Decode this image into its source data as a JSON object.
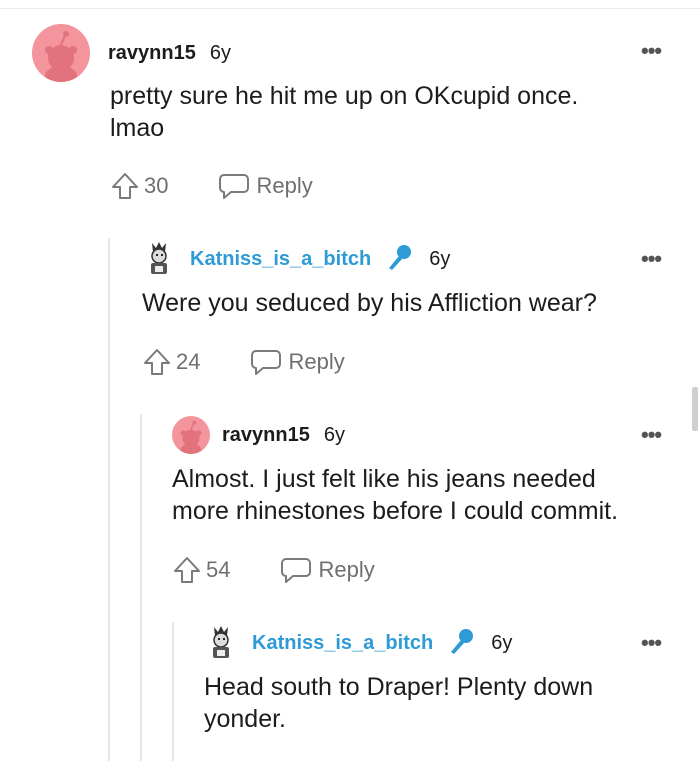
{
  "comments": [
    {
      "username": "ravynn15",
      "age": "6y",
      "body": [
        "pretty sure he hit me up on OKcupid once.",
        "lmao"
      ],
      "upvotes": "30",
      "reply_label": "Reply",
      "avatar": "reddit-snoo-avatar",
      "avatar_color": "#f4959e"
    },
    {
      "username": "Katniss_is_a_bitch",
      "age": "6y",
      "body": [
        "Were you seduced by his Affliction wear?"
      ],
      "upvotes": "24",
      "reply_label": "Reply",
      "avatar": "custom-avatar",
      "badge": "microphone-icon"
    },
    {
      "username": "ravynn15",
      "age": "6y",
      "body": [
        "Almost. I just felt like his jeans needed",
        "more rhinestones before I could commit."
      ],
      "upvotes": "54",
      "reply_label": "Reply",
      "avatar": "reddit-snoo-avatar",
      "avatar_color": "#f4959e"
    },
    {
      "username": "Katniss_is_a_bitch",
      "age": "6y",
      "body": [
        "Head south to Draper! Plenty down",
        "yonder."
      ],
      "avatar": "custom-avatar",
      "badge": "microphone-icon"
    }
  ],
  "colors": {
    "username_highlight": "#2e9bd6",
    "thread_line": "#e8e8e8",
    "muted": "#6f6f6f"
  }
}
